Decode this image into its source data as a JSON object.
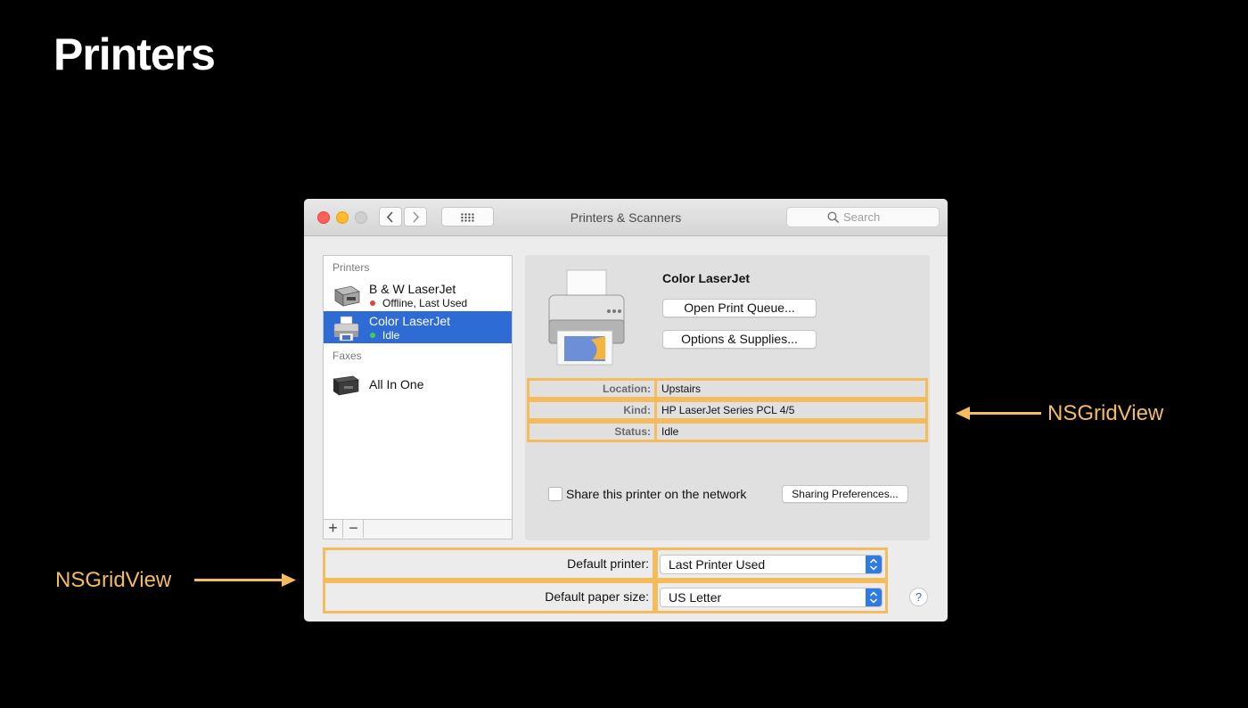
{
  "slide": {
    "title": "Printers"
  },
  "window": {
    "title": "Printers & Scanners",
    "search_placeholder": "Search"
  },
  "sidebar": {
    "printers_header": "Printers",
    "faxes_header": "Faxes",
    "items": [
      {
        "name": "B & W LaserJet",
        "status": "Offline, Last Used",
        "status_color": "#e5433c"
      },
      {
        "name": "Color LaserJet",
        "status": "Idle",
        "status_color": "#3fd04c",
        "selected": true
      },
      {
        "name": "All In One"
      }
    ],
    "add_label": "+",
    "remove_label": "−"
  },
  "detail": {
    "printer_name": "Color LaserJet",
    "open_queue_label": "Open Print Queue...",
    "options_label": "Options & Supplies...",
    "info": [
      {
        "label": "Location:",
        "value": "Upstairs"
      },
      {
        "label": "Kind:",
        "value": "HP LaserJet Series PCL 4/5"
      },
      {
        "label": "Status:",
        "value": "Idle"
      }
    ],
    "share_label": "Share this printer on the network",
    "share_checked": false,
    "sharing_prefs_label": "Sharing Preferences..."
  },
  "defaults": {
    "default_printer_label": "Default printer:",
    "default_printer_value": "Last Printer Used",
    "paper_size_label": "Default paper size:",
    "paper_size_value": "US Letter",
    "help_label": "?"
  },
  "annotations": {
    "right": "NSGridView",
    "left": "NSGridView"
  },
  "colors": {
    "highlight": "#f4bc5c",
    "selection": "#2f6bd5"
  }
}
